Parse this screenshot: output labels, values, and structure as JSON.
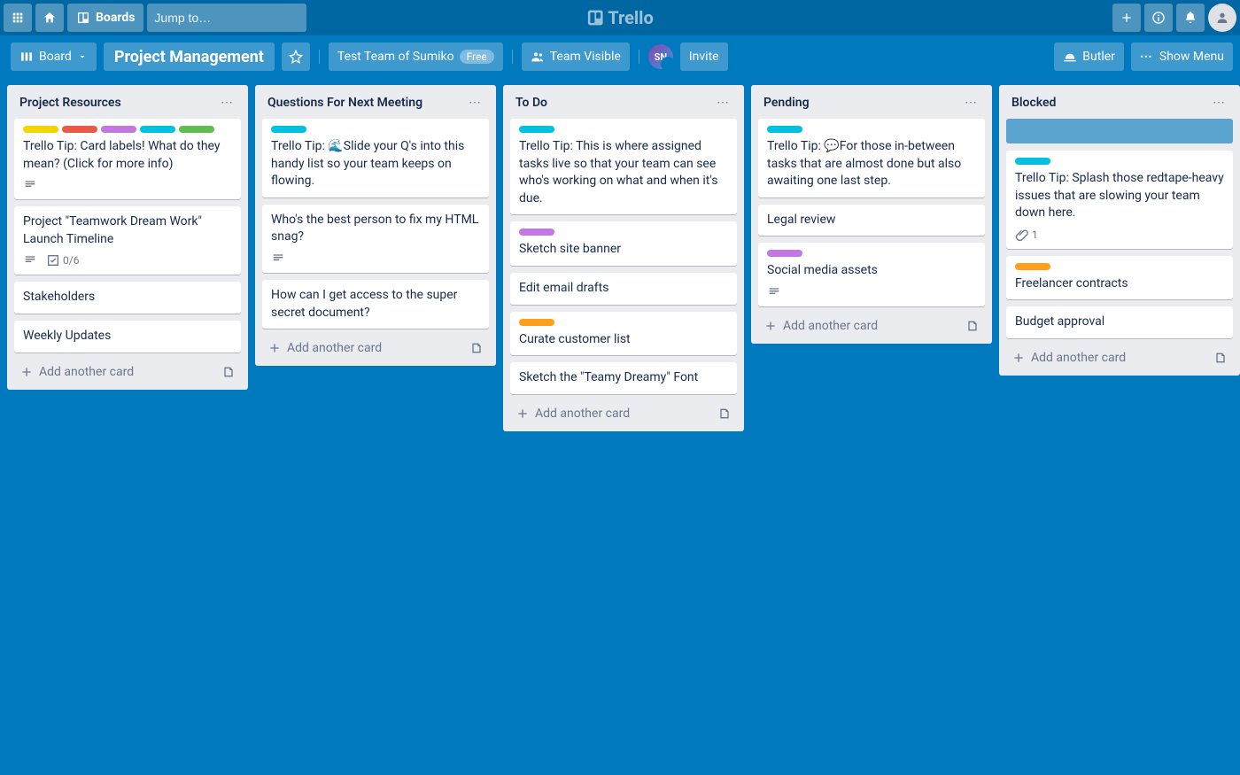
{
  "app": {
    "name": "Trello"
  },
  "topbar": {
    "boards": "Boards",
    "search_placeholder": "Jump to…"
  },
  "boardbar": {
    "view_switch": "Board",
    "board_name": "Project Management",
    "team_text": "Test Team of Sumiko",
    "team_plan": "Free",
    "visibility": "Team Visible",
    "member_initials": "SN",
    "invite": "Invite",
    "butler": "Butler",
    "show_menu": "Show Menu"
  },
  "labels": {
    "yellow": "#f2d600",
    "red": "#eb5a46",
    "purple": "#c377e0",
    "sky": "#00c2e0",
    "green": "#61bd4f",
    "orange": "#ff9f1a"
  },
  "lists": [
    {
      "title": "Project Resources",
      "add": "Add another card",
      "cards": [
        {
          "labels": [
            "yellow",
            "red",
            "purple",
            "sky",
            "green"
          ],
          "text": "Trello Tip: Card labels! What do they mean? (Click for more info)",
          "badges": [
            "desc"
          ]
        },
        {
          "labels": [],
          "text": "Project \"Teamwork Dream Work\" Launch Timeline",
          "badges": [
            "desc",
            "check"
          ],
          "check": "0/6"
        },
        {
          "labels": [],
          "text": "Stakeholders"
        },
        {
          "labels": [],
          "text": "Weekly Updates"
        }
      ]
    },
    {
      "title": "Questions For Next Meeting",
      "add": "Add another card",
      "cards": [
        {
          "labels": [
            "sky"
          ],
          "text": "Trello Tip: 🌊Slide your Q's into this handy list so your team keeps on flowing."
        },
        {
          "labels": [],
          "text": "Who's the best person to fix my HTML snag?",
          "badges": [
            "desc"
          ]
        },
        {
          "labels": [],
          "text": "How can I get access to the super secret document?"
        }
      ]
    },
    {
      "title": "To Do",
      "add": "Add another card",
      "cards": [
        {
          "labels": [
            "sky"
          ],
          "text": "Trello Tip: This is where assigned tasks live so that your team can see who's working on what and when it's due."
        },
        {
          "labels": [
            "purple"
          ],
          "text": "Sketch site banner"
        },
        {
          "labels": [],
          "text": "Edit email drafts"
        },
        {
          "labels": [
            "orange"
          ],
          "text": "Curate customer list"
        },
        {
          "labels": [],
          "text": "Sketch the \"Teamy Dreamy\" Font"
        }
      ]
    },
    {
      "title": "Pending",
      "add": "Add another card",
      "cards": [
        {
          "labels": [
            "sky"
          ],
          "text": "Trello Tip: 💬For those in-between tasks that are almost done but also awaiting one last step."
        },
        {
          "labels": [],
          "text": "Legal review"
        },
        {
          "labels": [
            "purple"
          ],
          "text": "Social media assets",
          "badges": [
            "desc"
          ]
        }
      ]
    },
    {
      "title": "Blocked",
      "add": "Add another card",
      "cards": [
        {
          "selected": true
        },
        {
          "labels": [
            "sky"
          ],
          "text": "Trello Tip: Splash those redtape-heavy issues that are slowing your team down here.",
          "badges": [
            "attach"
          ],
          "attach": "1"
        },
        {
          "labels": [
            "orange"
          ],
          "text": "Freelancer contracts"
        },
        {
          "labels": [],
          "text": "Budget approval"
        }
      ]
    }
  ]
}
